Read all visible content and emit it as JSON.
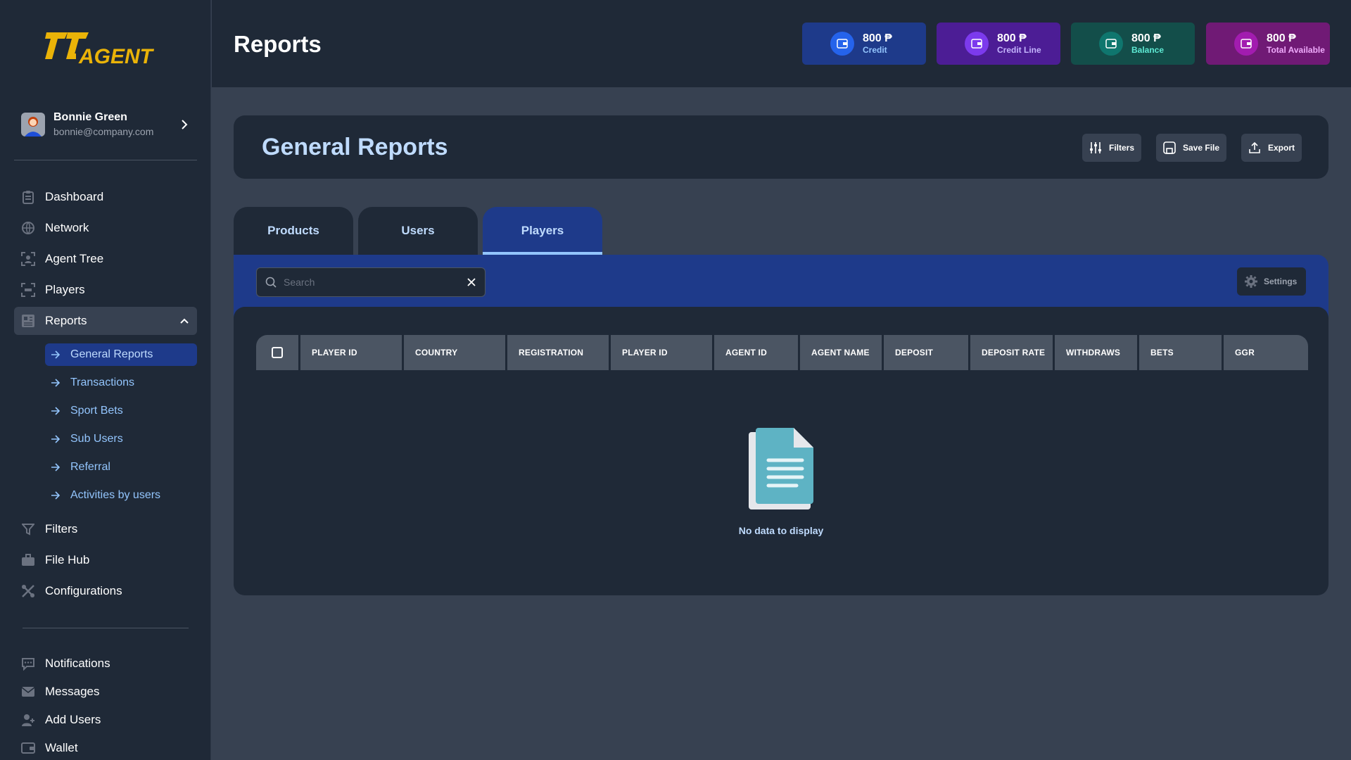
{
  "brand": {
    "logo_text": "777 AGENT",
    "accent": "#eab308"
  },
  "user": {
    "name": "Bonnie Green",
    "email": "bonnie@company.com"
  },
  "sidebar": {
    "items": [
      {
        "label": "Dashboard",
        "icon": "clipboard-icon"
      },
      {
        "label": "Network",
        "icon": "globe-icon"
      },
      {
        "label": "Agent Tree",
        "icon": "user-scan-icon"
      },
      {
        "label": "Players",
        "icon": "players-icon"
      },
      {
        "label": "Reports",
        "icon": "reports-icon"
      }
    ],
    "reports_sub": [
      {
        "label": "General Reports"
      },
      {
        "label": "Transactions"
      },
      {
        "label": "Sport Bets"
      },
      {
        "label": "Sub Users"
      },
      {
        "label": "Referral"
      },
      {
        "label": "Activities by users"
      }
    ],
    "items_after": [
      {
        "label": "Filters",
        "icon": "filter-icon"
      },
      {
        "label": "File Hub",
        "icon": "briefcase-icon"
      },
      {
        "label": "Configurations",
        "icon": "tools-icon"
      }
    ],
    "bottom": [
      {
        "label": "Notifications",
        "icon": "chat-icon"
      },
      {
        "label": "Messages",
        "icon": "mail-icon"
      },
      {
        "label": "Add Users",
        "icon": "user-add-icon"
      },
      {
        "label": "Wallet",
        "icon": "wallet-icon"
      }
    ]
  },
  "header": {
    "title": "Reports",
    "stats": [
      {
        "value": "800 ₱",
        "label": "Credit",
        "bg": "#1e3a8a",
        "icon_bg": "#2563eb",
        "label_color": "#93c5fd"
      },
      {
        "value": "800 ₱",
        "label": "Credit Line",
        "bg": "#4c1d95",
        "icon_bg": "#7c3aed",
        "label_color": "#c4b5fd"
      },
      {
        "value": "800 ₱",
        "label": "Balance",
        "bg": "#134e4a",
        "icon_bg": "#0f766e",
        "label_color": "#5eead4"
      },
      {
        "value": "800 ₱",
        "label": "Total Available",
        "bg": "#701a75",
        "icon_bg": "#a21caf",
        "label_color": "#f0abfc"
      }
    ]
  },
  "main": {
    "title": "General Reports",
    "buttons": {
      "filters": "Filters",
      "save_file": "Save File",
      "export": "Export"
    },
    "tabs": [
      {
        "label": "Products"
      },
      {
        "label": "Users"
      },
      {
        "label": "Players"
      }
    ],
    "active_tab": "Players",
    "search": {
      "placeholder": "Search",
      "value": ""
    },
    "settings_label": "Settings",
    "columns": [
      "PLAYER ID",
      "COUNTRY",
      "REGISTRATION",
      "PLAYER ID",
      "AGENT ID",
      "AGENT NAME",
      "DEPOSIT",
      "DEPOSIT RATE",
      "WITHDRAWS",
      "BETS",
      "GGR"
    ],
    "empty_text": "No data to display"
  }
}
